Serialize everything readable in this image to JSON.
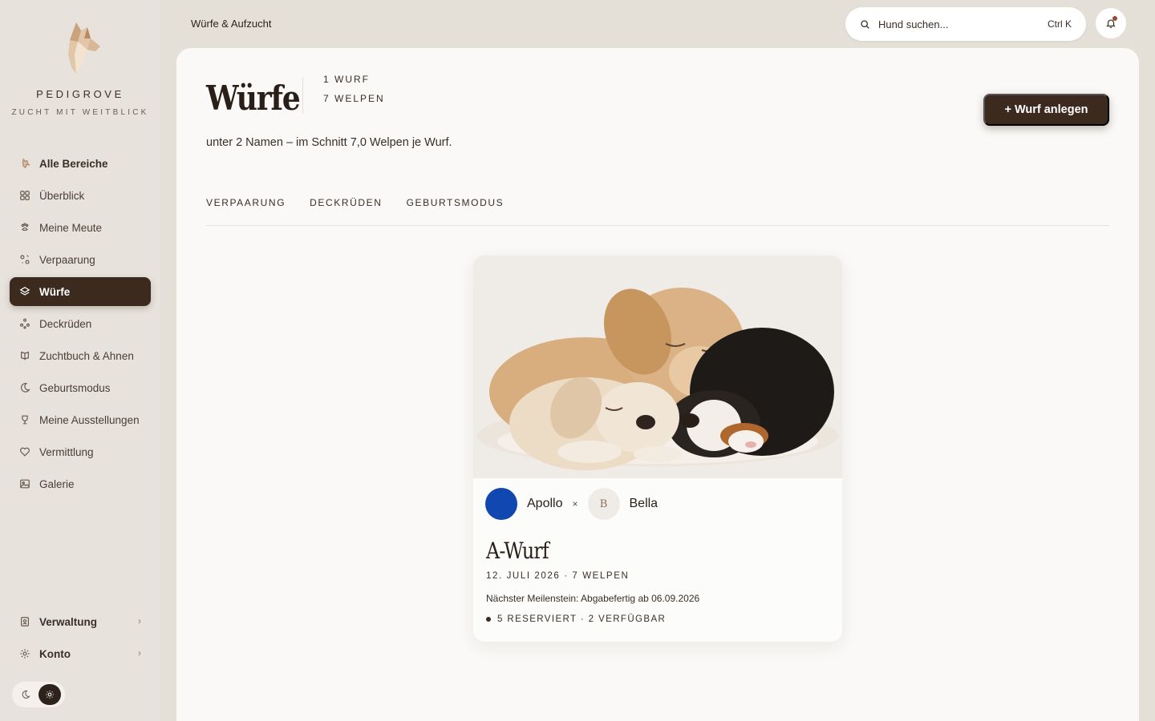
{
  "brand": {
    "name": "PEDIGROVE",
    "tagline": "ZUCHT MIT WEITBLICK"
  },
  "sidebar": {
    "items": [
      {
        "label": "Alle Bereiche",
        "icon": "dog-icon"
      },
      {
        "label": "Überblick",
        "icon": "grid-icon"
      },
      {
        "label": "Meine Meute",
        "icon": "paw-icon"
      },
      {
        "label": "Verpaarung",
        "icon": "pairing-icon"
      },
      {
        "label": "Würfe",
        "icon": "layers-icon",
        "active": true
      },
      {
        "label": "Deckrüden",
        "icon": "nodes-icon"
      },
      {
        "label": "Zuchtbuch & Ahnen",
        "icon": "book-icon"
      },
      {
        "label": "Geburtsmodus",
        "icon": "moon-icon"
      },
      {
        "label": "Meine Ausstellungen",
        "icon": "trophy-icon"
      },
      {
        "label": "Vermittlung",
        "icon": "heart-icon"
      },
      {
        "label": "Galerie",
        "icon": "image-icon"
      }
    ],
    "bottom": [
      {
        "label": "Verwaltung",
        "icon": "badge-icon"
      },
      {
        "label": "Konto",
        "icon": "gear-icon"
      }
    ]
  },
  "header": {
    "breadcrumb": "Würfe & Aufzucht",
    "search_placeholder": "Hund suchen...",
    "search_shortcut": "Ctrl K"
  },
  "page": {
    "title": "Würfe",
    "stat_litters": "1 WURF",
    "stat_puppies": "7 WELPEN",
    "subtitle": "unter 2 Namen – im Schnitt 7,0 Welpen je Wurf.",
    "add_button": "+ Wurf anlegen",
    "tabs": [
      "VERPAARUNG",
      "DECKRÜDEN",
      "GEBURTSMODUS"
    ]
  },
  "litter": {
    "sire": "Apollo",
    "sire_color": "#1047b0",
    "times": "×",
    "dam": "Bella",
    "dam_initial": "B",
    "name": "A-Wurf",
    "meta": "12. JULI 2026 · 7 WELPEN",
    "milestone": "Nächster Meilenstein: Abgabefertig ab 06.09.2026",
    "reservations": "5 RESERVIERT · 2 VERFÜGBAR"
  },
  "colors": {
    "accent": "#3d2a1f",
    "background": "#e4e0d8",
    "panel": "#faf9f7"
  }
}
